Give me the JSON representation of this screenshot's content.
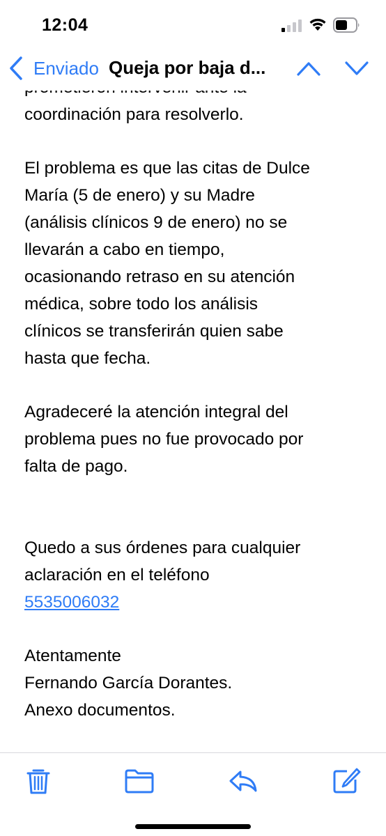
{
  "status_bar": {
    "time": "12:04"
  },
  "nav": {
    "back_label": "Enviado",
    "title": "Queja por baja d...",
    "accent_color": "#2f7cf6"
  },
  "email": {
    "partial_line": "prometieron intervenir ante la",
    "para1_end": "coordinación para resolverlo.",
    "para2": "El problema es que las citas de Dulce\nMaría (5 de enero) y su Madre\n(análisis clínicos 9 de enero) no se\nllevarán a cabo en tiempo,\nocasionando retraso en su atención\nmédica, sobre todo los análisis\nclínicos se transferirán quien sabe\nhasta que fecha.",
    "para3": "Agradeceré la atención integral del\nproblema pues no fue provocado por\nfalta de pago.",
    "para4": "Quedo a sus órdenes para cualquier\naclaración en el teléfono",
    "phone": "5535006032",
    "closing": "Atentamente\nFernando García Dorantes.\nAnexo documentos."
  },
  "toolbar": {
    "icons": [
      "trash-icon",
      "folder-icon",
      "reply-icon",
      "compose-icon"
    ]
  }
}
